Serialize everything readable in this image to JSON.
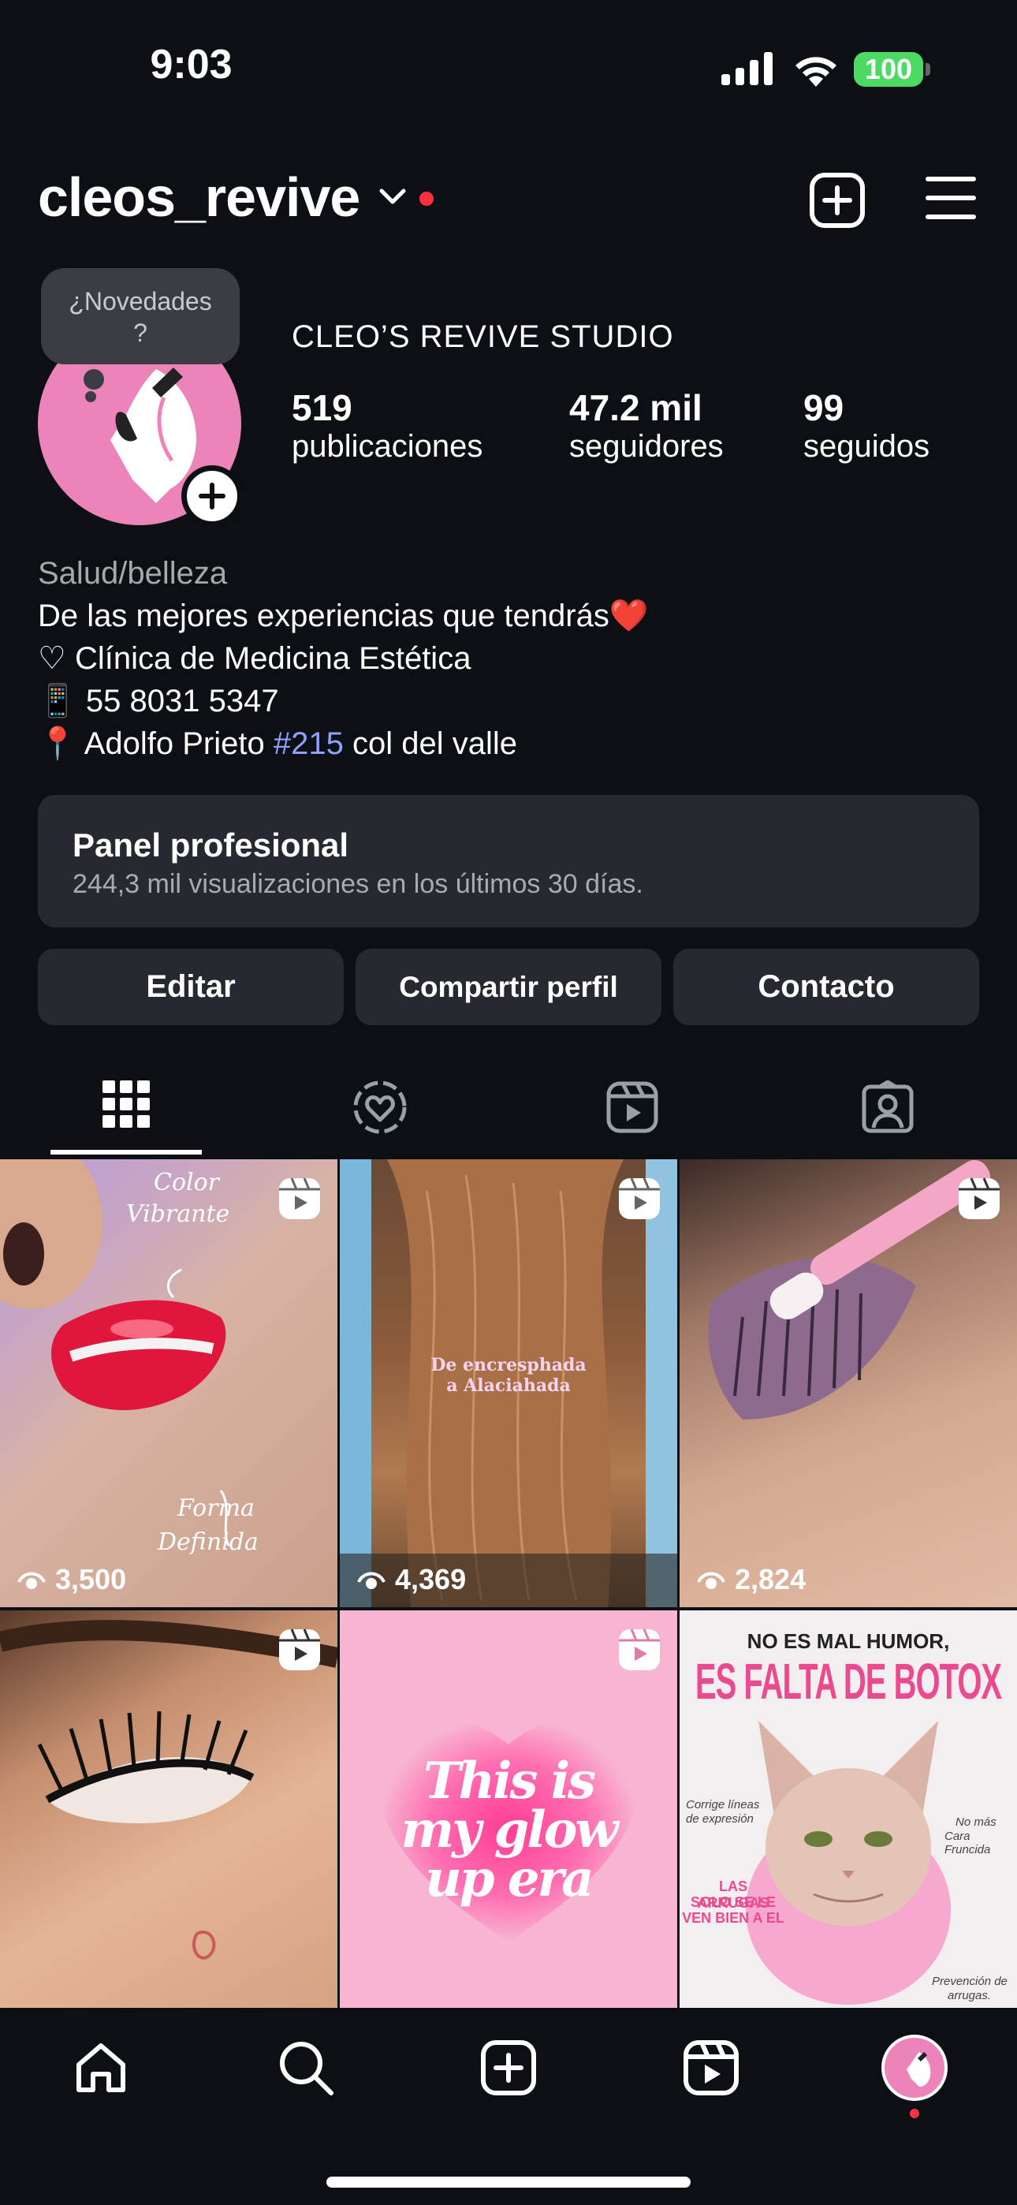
{
  "status_bar": {
    "time": "9:03",
    "battery": "100"
  },
  "header": {
    "username": "cleos_revive"
  },
  "tooltip": {
    "line1": "¿Novedades",
    "line2": "?"
  },
  "profile": {
    "name": "CLEO’S REVIVE STUDIO",
    "stats": [
      {
        "value": "519",
        "label": "publicaciones"
      },
      {
        "value": "47.2 mil",
        "label": "seguidores"
      },
      {
        "value": "99",
        "label": "seguidos"
      }
    ]
  },
  "bio": {
    "category": "Salud/belleza",
    "line1": "De las mejores experiencias que tendrás❤️",
    "line2": "♡ Clínica de Medicina Estética",
    "line3": "📱 55 8031 5347",
    "line4_pre": "📍 Adolfo Prieto ",
    "line4_tag": "#215",
    "line4_post": " col del valle"
  },
  "panel": {
    "title": "Panel profesional",
    "subtitle": "244,3 mil visualizaciones en los últimos 30 días."
  },
  "buttons": {
    "edit": "Editar",
    "share": "Compartir perfil",
    "contact": "Contacto"
  },
  "grid": {
    "posts": [
      {
        "views": "3,500",
        "overlay": [
          "Color",
          "Vibrante",
          "Forma",
          "Definida"
        ]
      },
      {
        "views": "4,369",
        "overlay": [
          "De encresphada",
          "a Alaciahada"
        ]
      },
      {
        "views": "2,824"
      },
      {},
      {
        "overlay": [
          "This is",
          "my glow",
          "up era"
        ]
      },
      {
        "overlay": [
          "NO ES MAL HUMOR,",
          "ES FALTA DE BOTOX",
          "LAS ARRUGAS",
          "SOLO SE LE",
          "VEN BIEN A EL",
          "Corrige líneas",
          "de expresión",
          "No más",
          "Cara Fruncida",
          "Prevención de",
          "arrugas."
        ]
      }
    ]
  },
  "colors": {
    "background": "#0c1014",
    "surface": "#262a30",
    "accent_pink": "#ec84b9",
    "notification_red": "#ff3040",
    "link_blue": "#8ca3ff",
    "battery_green": "#4cd964"
  }
}
